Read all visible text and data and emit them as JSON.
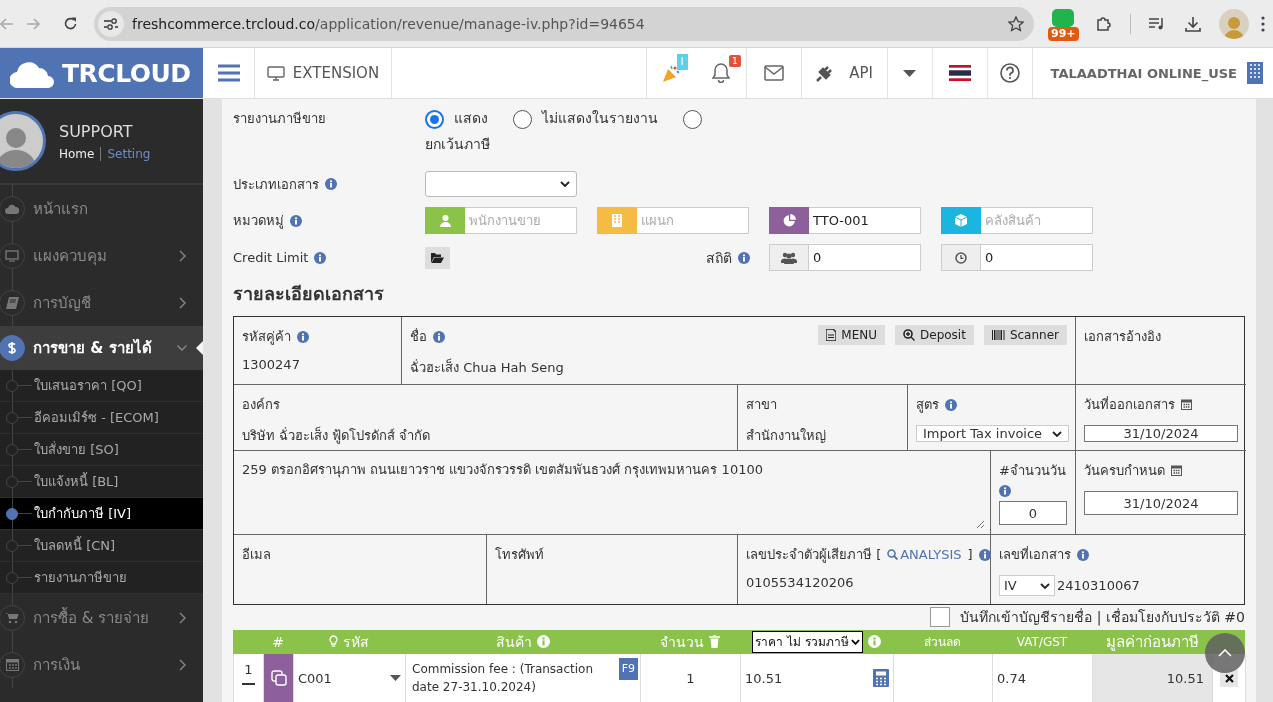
{
  "browser": {
    "url_host": "freshcommerce.trcloud.co",
    "url_path": "/application/revenue/manage-iv.php?id=94654",
    "extension_badge": "99+"
  },
  "header": {
    "logo": "TRCLOUD",
    "extension": "EXTENSION",
    "party_badge": "I",
    "bell_badge": "1",
    "api": "API",
    "user": "TALAADTHAI ONLINE_USE"
  },
  "sidebar": {
    "user": "SUPPORT",
    "home": "Home",
    "setting": "Setting",
    "items": [
      {
        "label": "หน้าแรก",
        "kind": "link",
        "selected": false
      },
      {
        "label": "แผงควบคุม",
        "kind": "menu",
        "selected": false,
        "expanded": false
      },
      {
        "label": "การบัญชี",
        "kind": "menu",
        "selected": false,
        "expanded": false
      },
      {
        "label": "การขาย & รายได้",
        "kind": "menu",
        "selected": true,
        "expanded": true,
        "children": [
          {
            "label": "ใบเสนอราคา [QO]",
            "selected": false
          },
          {
            "label": "อีคอมเมิร์ซ - [ECOM]",
            "selected": false
          },
          {
            "label": "ใบสั่งขาย [SO]",
            "selected": false
          },
          {
            "label": "ใบแจ้งหนี้ [BL]",
            "selected": false
          },
          {
            "label": "ใบกำกับภาษี [IV]",
            "selected": true
          },
          {
            "label": "ใบลดหนี้ [CN]",
            "selected": false
          },
          {
            "label": "รายงานภาษีขาย",
            "selected": false
          }
        ]
      },
      {
        "label": "การซื้อ & รายจ่าย",
        "kind": "menu",
        "selected": false,
        "expanded": false
      },
      {
        "label": "การเงิน",
        "kind": "menu",
        "selected": false,
        "expanded": false
      }
    ]
  },
  "tax_report": {
    "label": "รายงานภาษีขาย",
    "options": [
      {
        "label": "แสดง",
        "selected": true
      },
      {
        "label": "ไม่แสดงในรายงาน",
        "selected": false
      },
      {
        "label": "ยกเว้นภาษี",
        "selected": false
      }
    ]
  },
  "doc_type": {
    "label": "ประเภทเอกสาร"
  },
  "category": {
    "label": "หมวดหมู่",
    "fields": [
      {
        "placeholder": "พนักงานขาย",
        "color": "#8bc34a"
      },
      {
        "placeholder": "แผนก",
        "color": "#f6bb42"
      },
      {
        "value": "TTO-001",
        "color": "#8d5f9b"
      },
      {
        "placeholder": "คลังสินค้า",
        "color": "#1cb5e0"
      }
    ]
  },
  "credit_limit": {
    "label": "Credit Limit"
  },
  "stats": {
    "label": "สถิติ",
    "values": [
      "0",
      "0"
    ]
  },
  "details": {
    "title": "รายละเอียดเอกสาร",
    "customer_code": {
      "label": "รหัสคู่ค้า",
      "value": "1300247"
    },
    "name": {
      "label": "ชื่อ",
      "value": "ฉั่วฮะเส็ง Chua Hah Seng"
    },
    "buttons": [
      "MENU",
      "Deposit",
      "Scanner"
    ],
    "reference": {
      "label": "เอกสารอ้างอิง"
    },
    "organization": {
      "label": "องค์กร",
      "value": "บริษัท ฉั่วฮะเส็ง ฟู้ดโปรดักส์ จำกัด"
    },
    "branch": {
      "label": "สาขา",
      "value": "สำนักงานใหญ่"
    },
    "formula": {
      "label": "สูตร",
      "value": "Import Tax invoice"
    },
    "issue_date": {
      "label": "วันที่ออกเอกสาร",
      "value": "31/10/2024"
    },
    "address": "259 ตรอกอิศรานุภาพ ถนนเยาวราช แขวงจักรวรรดิ  เขตสัมพันธวงศ์ กรุงเทพมหานคร 10100",
    "days": {
      "label": "#จำนวนวัน",
      "value": "0"
    },
    "due_date": {
      "label": "วันครบกำหนด",
      "value": "31/10/2024"
    },
    "email": {
      "label": "อีเมล"
    },
    "phone": {
      "label": "โทรศัพท์"
    },
    "tax_id": {
      "label": "เลขประจำตัวผู้เสียภาษี [",
      "link": "ANALYSIS",
      "label_end": "]",
      "value": "0105534120206"
    },
    "doc_no": {
      "label": "เลขที่เอกสาร",
      "prefix": "IV",
      "value": "2410310067"
    }
  },
  "ledger": {
    "label": "บันทึกเข้าบัญชีรายชื่อ | เชื่อมโยงกับประวัติ #0",
    "checked": false
  },
  "items": {
    "columns": [
      "#",
      "รหัส",
      "สินค้า",
      "จำนวน",
      "ราคา ไม่ รวมภาษี",
      "ส่วนลด",
      "VAT/GST",
      "มูลค่าก่อนภาษี"
    ],
    "rows": [
      {
        "no": "1",
        "code": "C001",
        "product": "Commission fee : (Transaction date 27-31.10.2024)",
        "shortcut": "F9",
        "qty": "1",
        "price": "10.51",
        "vat": "0.74",
        "amount": "10.51"
      }
    ]
  }
}
